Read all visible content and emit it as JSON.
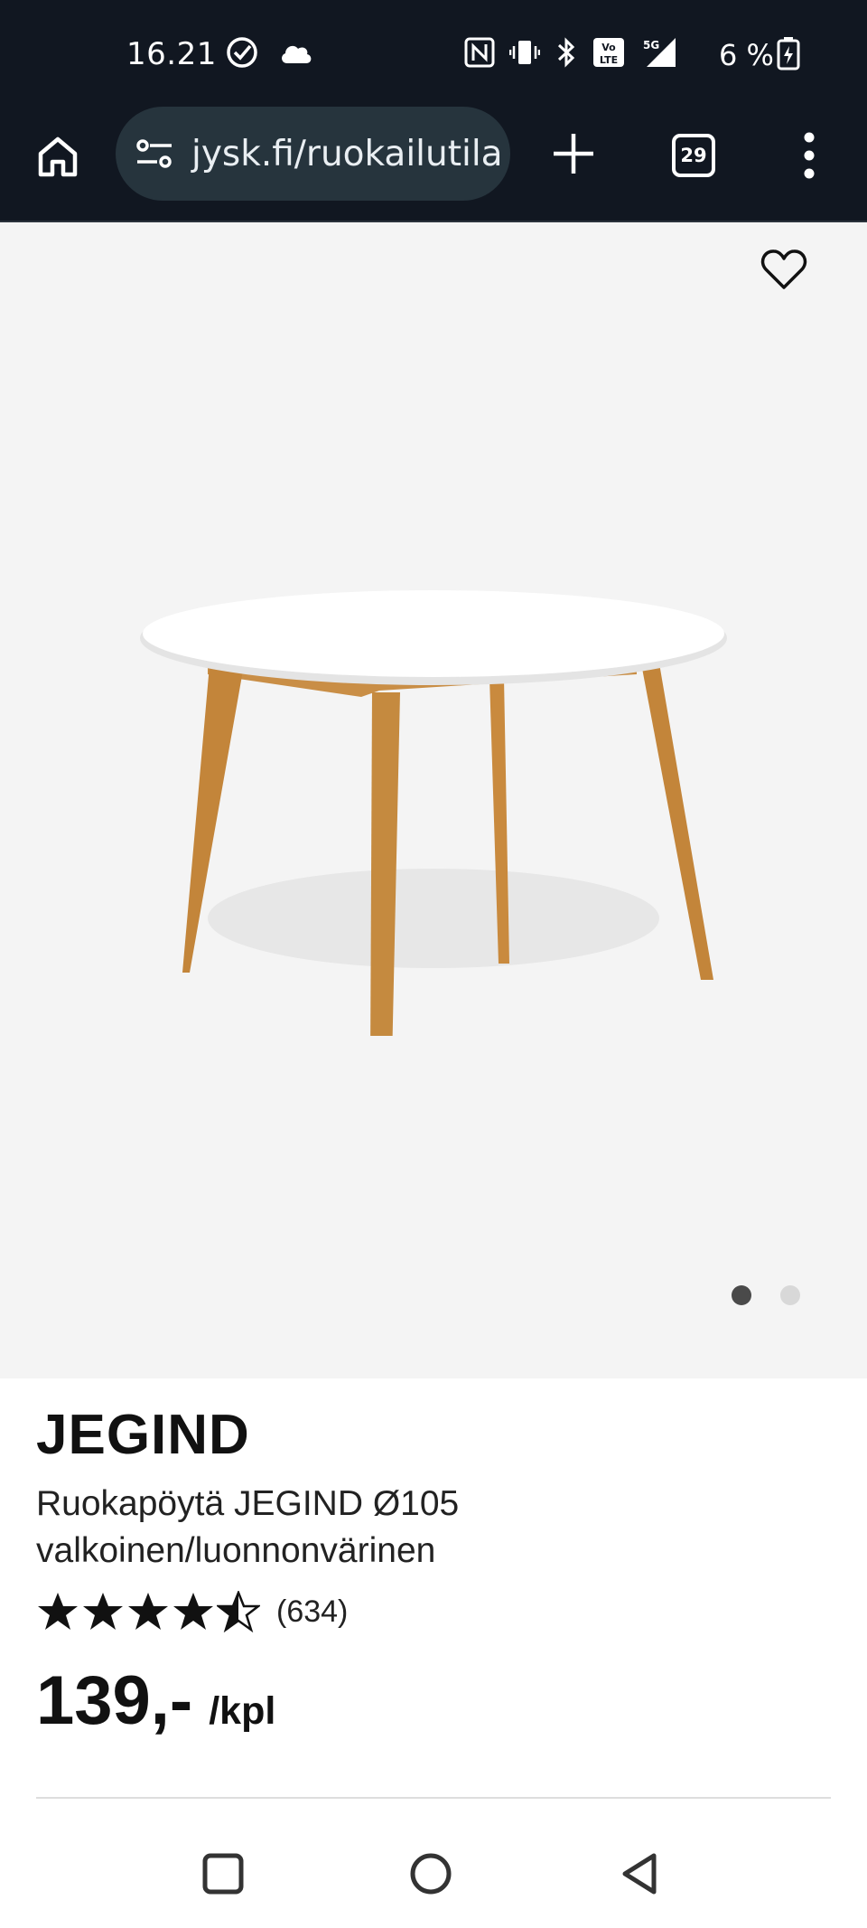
{
  "status_bar": {
    "time": "16.21",
    "battery": "6 %",
    "icons": [
      "check-circle-icon",
      "cloud-icon",
      "nfc-icon",
      "vibrate-icon",
      "bluetooth-icon",
      "volte-icon",
      "signal-5g-icon",
      "battery-charging-icon"
    ]
  },
  "browser": {
    "url": "jysk.fi/ruokailutila",
    "tab_count": "29",
    "icons": [
      "home-icon",
      "site-settings-icon",
      "new-tab-icon",
      "tabs-icon",
      "more-menu-icon"
    ]
  },
  "gallery": {
    "favorite_icon": "heart-icon",
    "image_count": 2,
    "active_index": 0
  },
  "product": {
    "brand": "JEGIND",
    "name_line1": "Ruokapöytä JEGIND Ø105",
    "name_line2": "valkoinen/luonnonvärinen",
    "rating": 4.5,
    "review_count": "(634)",
    "price": "139,-",
    "unit": "/kpl"
  },
  "colors": {
    "browser_bg": "#111721",
    "url_pill": "#26343d",
    "image_bg": "#f4f4f4",
    "text": "#111111"
  }
}
